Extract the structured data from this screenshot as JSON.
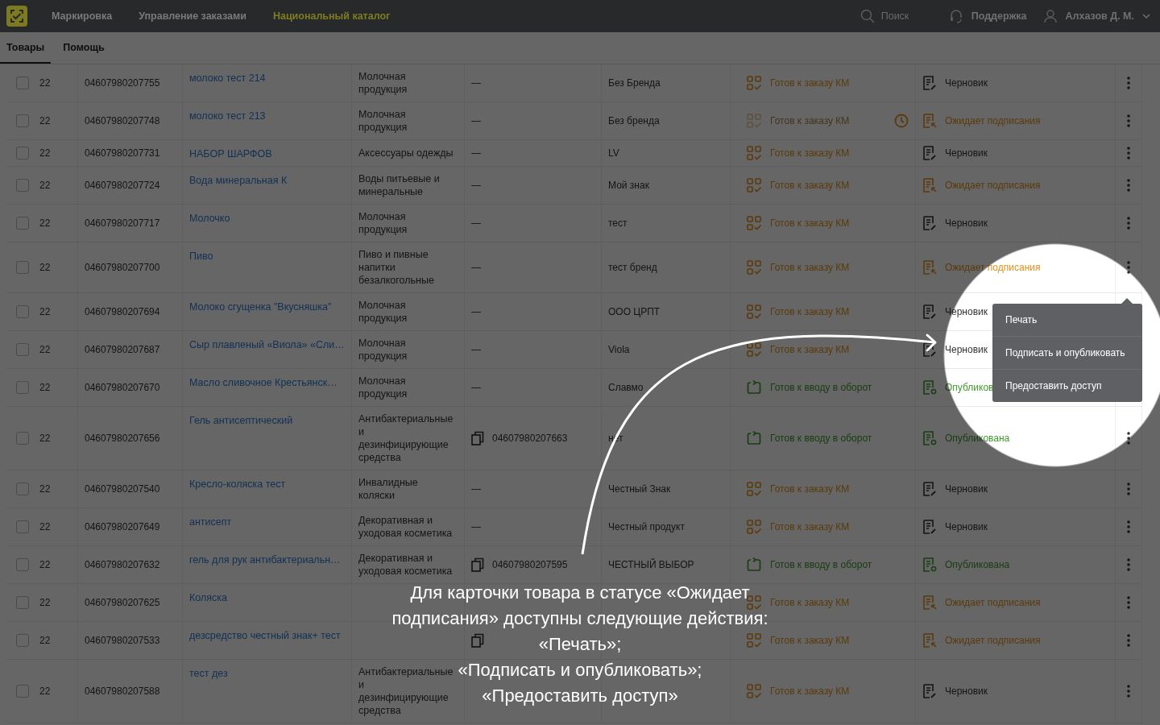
{
  "header": {
    "nav": [
      {
        "label": "Маркировка",
        "selected": false
      },
      {
        "label": "Управление заказами",
        "selected": false
      },
      {
        "label": "Национальный каталог",
        "selected": true
      }
    ],
    "search": {
      "placeholder": "Поиск"
    },
    "support": "Поддержка",
    "user": "Алхазов Д. М."
  },
  "tabs": [
    {
      "label": "Товары",
      "selected": true
    },
    {
      "label": "Помощь",
      "selected": false
    }
  ],
  "rows": [
    {
      "checked": false,
      "date": "22",
      "gtin": "04607980207755",
      "name": "молоко тест 214",
      "category": "Молочная продукция",
      "gtin2": {
        "kind": "none",
        "text": "—"
      },
      "brand": "Без Бренда",
      "km": {
        "kind": "order",
        "label": "Готов к заказу КМ",
        "disabled": false
      },
      "card": {
        "kind": "draft",
        "label": "Черновик"
      },
      "menu": true
    },
    {
      "checked": false,
      "date": "22",
      "gtin": "04607980207748",
      "name": "молоко тест 213",
      "category": "Молочная продукция",
      "gtin2": {
        "kind": "none",
        "text": "—"
      },
      "brand": "Без бренда",
      "km": {
        "kind": "order",
        "label": "Готов к заказу КМ",
        "disabled": true
      },
      "card": {
        "kind": "pending",
        "label": "Ожидает подписания"
      },
      "menu": true
    },
    {
      "checked": false,
      "date": "22",
      "gtin": "04607980207731",
      "name": "НАБОР ШАРФОВ",
      "category": "Аксессуары одежды",
      "gtin2": {
        "kind": "none",
        "text": "—"
      },
      "brand": "LV",
      "km": {
        "kind": "order",
        "label": "Готов к заказу КМ",
        "disabled": false
      },
      "card": {
        "kind": "draft",
        "label": "Черновик"
      },
      "menu": true
    },
    {
      "checked": false,
      "date": "22",
      "gtin": "04607980207724",
      "name": "Вода минеральная К",
      "category": "Воды питьевые и минеральные",
      "gtin2": {
        "kind": "none",
        "text": "—"
      },
      "brand": "Мой знак",
      "km": {
        "kind": "order",
        "label": "Готов к заказу КМ",
        "disabled": false
      },
      "card": {
        "kind": "pending",
        "label": "Ожидает подписания"
      },
      "menu": true
    },
    {
      "checked": false,
      "date": "22",
      "gtin": "04607980207717",
      "name": "Молочко",
      "category": "Молочная продукция",
      "gtin2": {
        "kind": "none",
        "text": "—"
      },
      "brand": "тест",
      "km": {
        "kind": "order",
        "label": "Готов к заказу КМ",
        "disabled": false
      },
      "card": {
        "kind": "draft",
        "label": "Черновик"
      },
      "menu": true
    },
    {
      "checked": false,
      "date": "22",
      "gtin": "04607980207700",
      "name": "Пиво",
      "category": "Пиво и пивные напитки безалкогольные",
      "gtin2": {
        "kind": "none",
        "text": "—"
      },
      "brand": "тест бренд",
      "km": {
        "kind": "order",
        "label": "Готов к заказу КМ",
        "disabled": false
      },
      "card": {
        "kind": "pending",
        "label": "Ожидает подписания"
      },
      "menu": true
    },
    {
      "checked": false,
      "date": "22",
      "gtin": "04607980207694",
      "name": "Молоко сгущенка \"Вкусняшка\"",
      "category": "Молочная продукция",
      "gtin2": {
        "kind": "none",
        "text": "—"
      },
      "brand": "ООО ЦРПТ",
      "km": {
        "kind": "order",
        "label": "Готов к заказу КМ",
        "disabled": false
      },
      "card": {
        "kind": "draft",
        "label": "Черновик"
      },
      "menu": false
    },
    {
      "checked": false,
      "date": "22",
      "gtin": "04607980207687",
      "name": "Сыр плавленый «Виола» «Сли…",
      "category": "Молочная продукция",
      "gtin2": {
        "kind": "none",
        "text": "—"
      },
      "brand": "Viola",
      "km": {
        "kind": "order",
        "label": "Готов к заказу КМ",
        "disabled": false
      },
      "card": {
        "kind": "draft",
        "label": "Черновик"
      },
      "menu": false
    },
    {
      "checked": false,
      "date": "22",
      "gtin": "04607980207670",
      "name": "Масло сливочное Крестьянск…",
      "category": "Молочная продукция",
      "gtin2": {
        "kind": "none",
        "text": "—"
      },
      "brand": "Славмо",
      "km": {
        "kind": "circulation",
        "label": "Готов к вводу в оборот",
        "disabled": false
      },
      "card": {
        "kind": "published",
        "label": "Опубликов"
      },
      "menu": false
    },
    {
      "checked": false,
      "date": "22",
      "gtin": "04607980207656",
      "name": "Гель антисептический",
      "category": "Антибактериальные и дезинфицирующие средства",
      "gtin2": {
        "kind": "code",
        "text": "04607980207663"
      },
      "brand": "нет",
      "km": {
        "kind": "circulation",
        "label": "Готов к вводу в оборот",
        "disabled": false
      },
      "card": {
        "kind": "published",
        "label": "Опубликована"
      },
      "menu": true
    },
    {
      "checked": false,
      "date": "22",
      "gtin": "04607980207540",
      "name": "Кресло-коляска тест",
      "category": "Инвалидные коляски",
      "gtin2": {
        "kind": "none",
        "text": "—"
      },
      "brand": "Честный Знак",
      "km": {
        "kind": "order",
        "label": "Готов к заказу КМ",
        "disabled": false
      },
      "card": {
        "kind": "draft",
        "label": "Черновик"
      },
      "menu": true
    },
    {
      "checked": false,
      "date": "22",
      "gtin": "04607980207649",
      "name": "антисепт",
      "category": "Декоративная и уходовая косметика",
      "gtin2": {
        "kind": "none",
        "text": "—"
      },
      "brand": "Честный продукт",
      "km": {
        "kind": "order",
        "label": "Готов к заказу КМ",
        "disabled": false
      },
      "card": {
        "kind": "draft",
        "label": "Черновик"
      },
      "menu": true
    },
    {
      "checked": false,
      "date": "22",
      "gtin": "04607980207632",
      "name": "гель для рук антибактериальн…",
      "category": "Декоративная и уходовая косметика",
      "gtin2": {
        "kind": "code",
        "text": "04607980207595"
      },
      "brand": "ЧЕСТНЫЙ ВЫБОР",
      "km": {
        "kind": "circulation",
        "label": "Готов к вводу в оборот",
        "disabled": false
      },
      "card": {
        "kind": "published",
        "label": "Опубликована"
      },
      "menu": true
    },
    {
      "checked": false,
      "date": "22",
      "gtin": "04607980207625",
      "name": "Коляска",
      "km": {
        "kind": "order",
        "label": "Готов к заказу КМ",
        "disabled": false
      },
      "card": {
        "kind": "pending",
        "label": "Ожидает подписания"
      },
      "menu": true
    },
    {
      "checked": false,
      "date": "22",
      "gtin": "04607980207533",
      "name": "дезсредство честный знак+ тест",
      "gtin2": {
        "kind": "icon"
      },
      "km": {
        "kind": "order",
        "label": "Готов к заказу КМ",
        "disabled": false
      },
      "card": {
        "kind": "pending",
        "label": "Ожидает подписания"
      },
      "menu": true
    },
    {
      "checked": false,
      "date": "22",
      "gtin": "04607980207588",
      "name": "тест дез",
      "category": "Антибактериальные и дезинфицирующие средства",
      "km": {
        "kind": "order",
        "label": "Готов к заказу КМ",
        "disabled": false
      },
      "card": {
        "kind": "draft",
        "label": "Черновик"
      },
      "menu": true
    }
  ],
  "menu": {
    "items": [
      "Печать",
      "Подписать и опубликовать",
      "Предоставить доступ"
    ]
  },
  "caption": [
    "Для карточки товара в статусе «Ожидает",
    "подписания» доступны следующие действия:",
    "«Печать»;",
    "«Подписать и опубликовать»;",
    "«Предоставить доступ»"
  ]
}
